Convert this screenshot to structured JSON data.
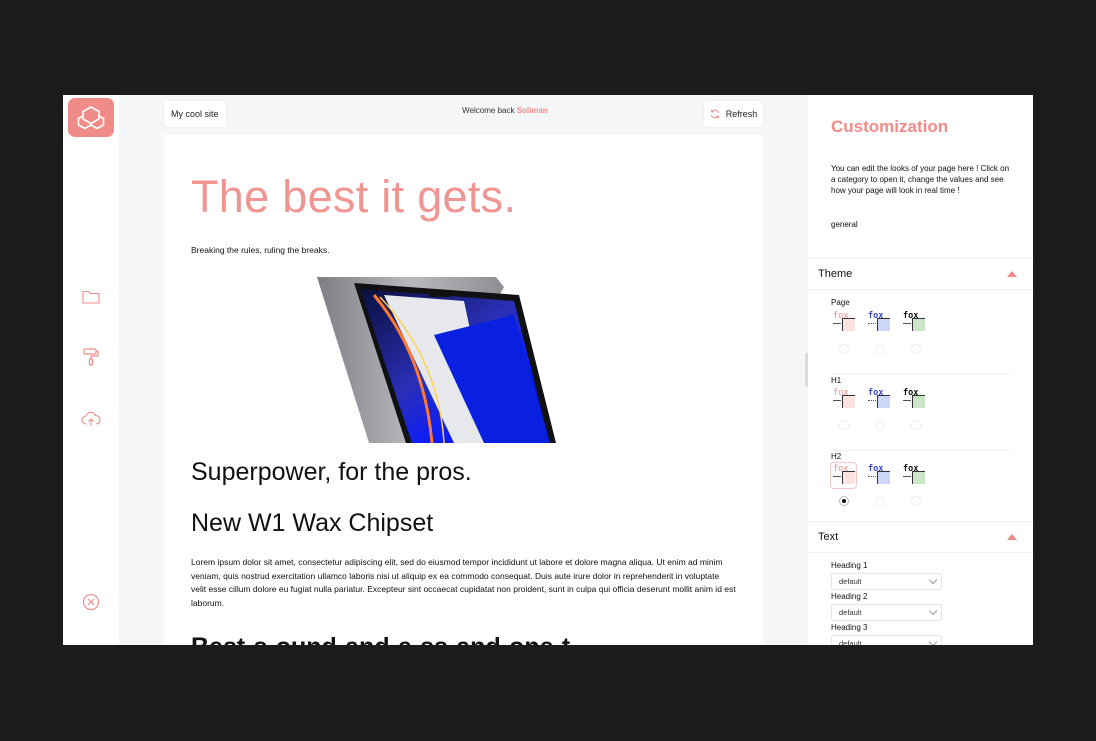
{
  "topbar": {
    "site_name": "My cool site",
    "welcome_prefix": "Welcome back ",
    "user_name": "Soliman",
    "refresh_label": "Refresh"
  },
  "content": {
    "hero_title": "The best it gets.",
    "hero_subtitle": "Breaking the rules, ruling the breaks.",
    "heading_1": "Superpower, for the pros.",
    "heading_2": "New W1 Wax Chipset",
    "paragraph": "Lorem ipsum dolor sit amet, consectetur adipiscing elit, sed do eiusmod tempor incididunt ut labore et dolore magna aliqua. Ut enim ad minim veniam, quis nostrud exercitation ullamco laboris nisi ut aliquip ex ea commodo consequat. Duis aute irure dolor in reprehenderit in voluptate velit esse cillum dolore eu fugiat nulla pariatur. Excepteur sint occaecat cupidatat non proident, sunt in culpa qui officia deserunt mollit anim id est laborum.",
    "heading_3_partial": "Best-s-ound-and-e-ss-and-one-t-"
  },
  "rail": {
    "icons": [
      "folder-icon",
      "paint-roller-icon",
      "cloud-upload-icon",
      "close-circle-icon"
    ]
  },
  "panel": {
    "title": "Customization",
    "description": "You can edit the looks of your page here ! Click on a category to open it, change the values and see how your page will look in real time !",
    "general_label": "general",
    "theme": {
      "label": "Theme",
      "groups": [
        {
          "label": "Page",
          "selected": -1
        },
        {
          "label": "H1",
          "selected": -1
        },
        {
          "label": "H2",
          "selected": 0
        }
      ],
      "swatch_text": "fox",
      "palettes": [
        {
          "text": "#f08c88",
          "bg": "#fde3e0"
        },
        {
          "text": "#3b48c7",
          "bg": "#cdd6f8"
        },
        {
          "text": "#111111",
          "bg": "#c9e6c7"
        }
      ]
    },
    "text": {
      "label": "Text",
      "fields": [
        {
          "label": "Heading 1",
          "value": "default"
        },
        {
          "label": "Heading 2",
          "value": "default"
        },
        {
          "label": "Heading 3",
          "value": "default"
        }
      ]
    }
  },
  "colors": {
    "accent": "#f08c88",
    "background": "#1b1b1b"
  }
}
